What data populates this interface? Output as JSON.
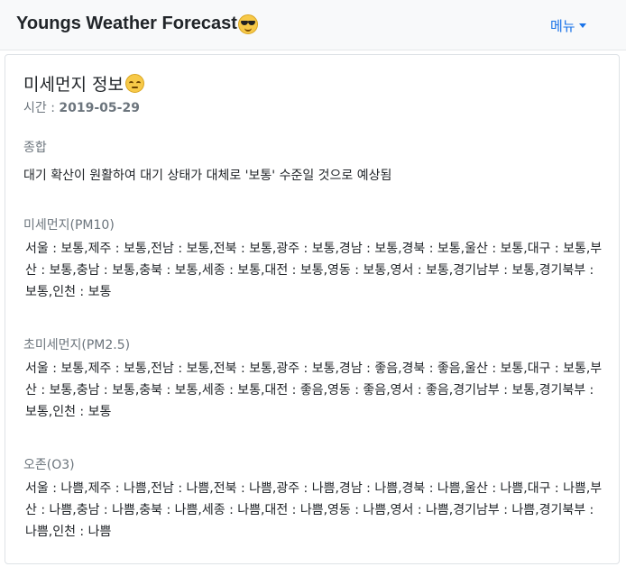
{
  "header": {
    "brand": "Youngs Weather Forecast",
    "brand_icon": "sunglasses-emoji",
    "menu_label": "메뉴"
  },
  "card": {
    "title": "미세먼지 정보",
    "title_icon": "relieved-face-emoji",
    "date_label": "시간 : ",
    "date_value": "2019-05-29",
    "summary": {
      "label": "종합",
      "text": "대기 확산이 원활하여 대기 상태가 대체로 '보통' 수준일 것으로 예상됨"
    },
    "pm10": {
      "label": "미세먼지(PM10)",
      "text": "서울 : 보통,제주 : 보통,전남 : 보통,전북 : 보통,광주 : 보통,경남 : 보통,경북 : 보통,울산 : 보통,대구 : 보통,부산 : 보통,충남 : 보통,충북 : 보통,세종 : 보통,대전 : 보통,영동 : 보통,영서 : 보통,경기남부 : 보통,경기북부 : 보통,인천 : 보통"
    },
    "pm25": {
      "label": "초미세먼지(PM2.5)",
      "text": "서울 : 보통,제주 : 보통,전남 : 보통,전북 : 보통,광주 : 보통,경남 : 좋음,경북 : 좋음,울산 : 보통,대구 : 보통,부산 : 보통,충남 : 보통,충북 : 보통,세종 : 보통,대전 : 좋음,영동 : 좋음,영서 : 좋음,경기남부 : 보통,경기북부 : 보통,인천 : 보통"
    },
    "o3": {
      "label": "오존(O3)",
      "text": "서울 : 나쁨,제주 : 나쁨,전남 : 나쁨,전북 : 나쁨,광주 : 나쁨,경남 : 나쁨,경북 : 나쁨,울산 : 나쁨,대구 : 나쁨,부산 : 나쁨,충남 : 나쁨,충북 : 나쁨,세종 : 나쁨,대전 : 나쁨,영동 : 나쁨,영서 : 나쁨,경기남부 : 나쁨,경기북부 : 나쁨,인천 : 나쁨"
    }
  },
  "colors": {
    "navbar_bg": "#f8f9fa",
    "link": "#1a73e8",
    "muted": "#6c757d",
    "text": "#212529"
  }
}
